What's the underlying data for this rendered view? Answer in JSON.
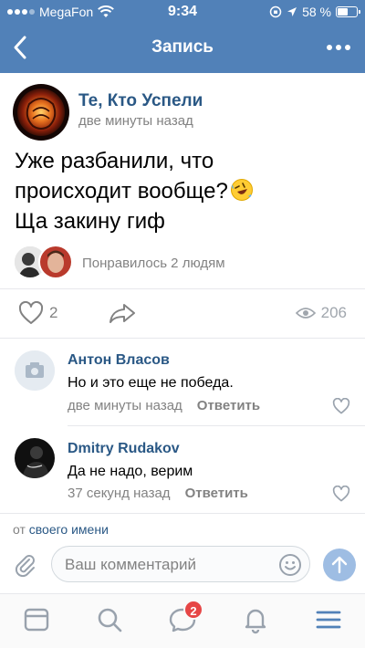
{
  "status_bar": {
    "carrier": "MegaFon",
    "time": "9:34",
    "battery_text": "58 %",
    "battery_level": 0.58
  },
  "nav": {
    "title": "Запись"
  },
  "post": {
    "author": "Те, Кто Успели",
    "time": "две минуты назад",
    "text_lines": [
      "Уже разбанили, что",
      "происходит вообще?",
      "Ща закину гиф"
    ],
    "emoji": "rolling-on-floor-laughing",
    "liked_text": "Понравилось 2 людям",
    "likes": "2",
    "views": "206"
  },
  "comments": [
    {
      "name": "Антон Власов",
      "text": "Но и это еще не победа.",
      "time": "две минуты назад",
      "reply": "Ответить"
    },
    {
      "name": "Dmitry Rudakov",
      "text": "Да не надо, верим",
      "time": "37 секунд назад",
      "reply": "Ответить"
    }
  ],
  "compose": {
    "from_prefix": "от",
    "from_link": "своего имени",
    "placeholder": "Ваш комментарий"
  },
  "tabbar": {
    "messages_badge": "2"
  },
  "colors": {
    "header": "#5181b8",
    "link": "#2a5885",
    "muted": "#828282",
    "badge": "#e64646"
  }
}
